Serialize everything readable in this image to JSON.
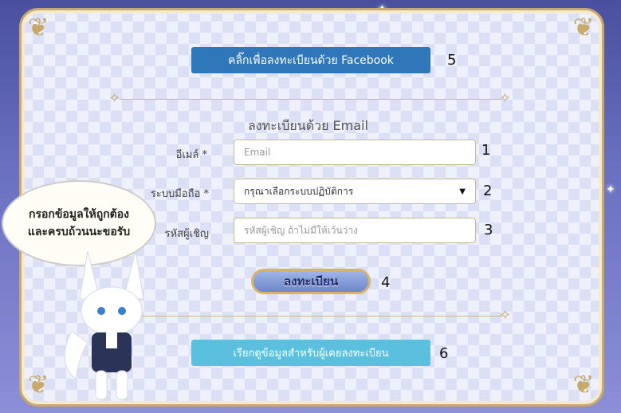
{
  "facebook_button": {
    "label": "คลิ๊กเพื่อลงทะเบียนด้วย Facebook",
    "number": "5"
  },
  "email_section": {
    "title": "ลงทะเบียนด้วย Email"
  },
  "fields": [
    {
      "label": "อีเมล์ *",
      "placeholder": "Email",
      "number": "1"
    },
    {
      "label": "ระบบมือถือ *",
      "value": "กรุณาเลือกระบบปฏิบัติการ",
      "number": "2"
    },
    {
      "label": "รหัสผู้เชิญ",
      "placeholder": "รหัสผู้เชิญ ถ้าไม่มีให้เว้นว่าง",
      "number": "3"
    }
  ],
  "register_button": {
    "label": "ลงทะเบียน",
    "number": "4"
  },
  "recall_button": {
    "label": "เรียกดูข้อมูลสำหรับผู้เคยลงทะเบียน",
    "number": "6"
  },
  "speech_bubble": {
    "line1": "กรอกข้อมูลให้ถูกต้อง",
    "line2": "และครบถ้วนนะขอรับ"
  },
  "colors": {
    "facebook": "#2f77b8",
    "recall": "#5bc0de",
    "gold": "#c9a96b"
  },
  "icons": {
    "dropdown": "chevron-down-icon",
    "divider": "ornament-icon"
  }
}
